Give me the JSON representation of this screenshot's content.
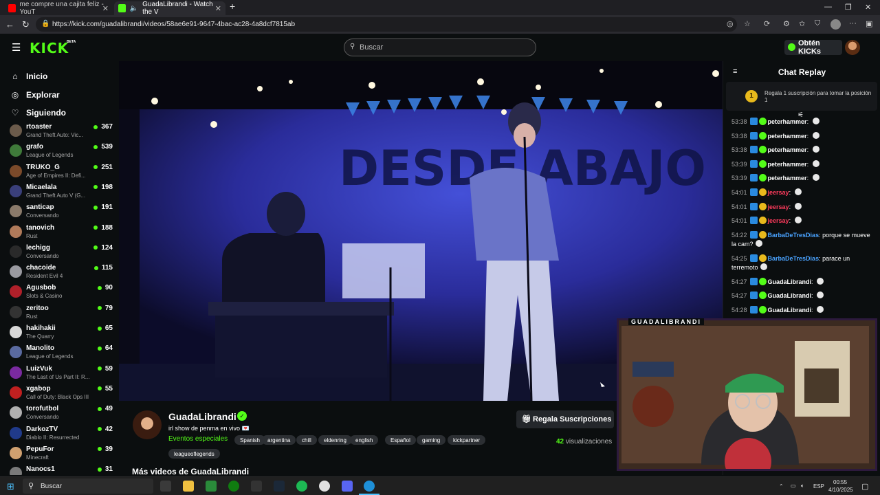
{
  "browser": {
    "tabs": [
      {
        "title": "me compre una cajita feliz - YouT",
        "favicon_color": "#ff0000"
      },
      {
        "title": "GuadaLibrandi - Watch the V",
        "favicon_color": "#53fc18"
      }
    ],
    "url": "https://kick.com/guadalibrandi/videos/58ae6e91-9647-4bac-ac28-4a8dcf7815ab"
  },
  "header": {
    "logo": "KICK",
    "logo_badge": "BETA",
    "search_placeholder": "Buscar",
    "kicks_button": "Obtén KICKs"
  },
  "sidebar": {
    "nav": [
      {
        "label": "Inicio",
        "icon": "home-icon"
      },
      {
        "label": "Explorar",
        "icon": "compass-icon"
      },
      {
        "label": "Siguiendo",
        "icon": "heart-icon"
      }
    ],
    "channels": [
      {
        "name": "rtoaster",
        "game": "Grand Theft Auto: Vic...",
        "viewers": "367",
        "color": "#6b5b4b"
      },
      {
        "name": "grafo",
        "game": "League of Legends",
        "viewers": "539",
        "color": "#3f7a3a"
      },
      {
        "name": "TRUKO_G",
        "game": "Age of Empires II: Defi...",
        "viewers": "251",
        "color": "#7b4a2a"
      },
      {
        "name": "Micaelala",
        "game": "Grand Theft Auto V (G...",
        "viewers": "198",
        "color": "#3a3f7a"
      },
      {
        "name": "santicap",
        "game": "Conversando",
        "viewers": "191",
        "color": "#8a7a6a"
      },
      {
        "name": "tanovich",
        "game": "Rust",
        "viewers": "188",
        "color": "#b07a5a"
      },
      {
        "name": "lechigg",
        "game": "Conversando",
        "viewers": "124",
        "color": "#2a2a2a"
      },
      {
        "name": "chacoide",
        "game": "Resident Evil 4",
        "viewers": "115",
        "color": "#9a9aa0"
      },
      {
        "name": "Agusbob",
        "game": "Slots & Casino",
        "viewers": "90",
        "color": "#b0202a"
      },
      {
        "name": "zeritoo",
        "game": "Rust",
        "viewers": "79",
        "color": "#333"
      },
      {
        "name": "hakihakii",
        "game": "The Quarry",
        "viewers": "65",
        "color": "#d8d8d8"
      },
      {
        "name": "Manolito",
        "game": "League of Legends",
        "viewers": "64",
        "color": "#5a6aa0"
      },
      {
        "name": "LuizVuk",
        "game": "The Last of Us Part II: R...",
        "viewers": "59",
        "color": "#7a2aa0"
      },
      {
        "name": "xgabop",
        "game": "Call of Duty: Black Ops III",
        "viewers": "55",
        "color": "#c02020"
      },
      {
        "name": "torofutbol",
        "game": "Conversando",
        "viewers": "49",
        "color": "#b0b0b0"
      },
      {
        "name": "DarkozTV",
        "game": "Diablo II: Resurrected",
        "viewers": "42",
        "color": "#203a8a"
      },
      {
        "name": "PepuFor",
        "game": "Minecraft",
        "viewers": "39",
        "color": "#d0a070"
      },
      {
        "name": "Nanocs1",
        "game": "",
        "viewers": "31",
        "color": "#7a7a7a"
      }
    ]
  },
  "video": {
    "backdrop_text": "DESDE ABAJO"
  },
  "stream_info": {
    "streamer": "GuadaLibrandi",
    "title": "irl show de penma en vivo 💌",
    "category": "Eventos especiales",
    "tags": [
      "Spanish",
      "argentina",
      "chill",
      "eldenring",
      "english",
      "Español",
      "gaming",
      "kickpartner",
      "leagueoflegends"
    ],
    "gift_button": "Regala Suscripciones",
    "views_count": "42",
    "views_label": "visualizaciones",
    "more_videos": "Más videos de GuadaLibrandi"
  },
  "chat": {
    "title": "Chat Replay",
    "gift_banner_count": "1",
    "gift_banner_text": "Regala 1 suscripción para tomar la posición 1",
    "messages": [
      {
        "time": "53:38",
        "user": "peterhammer",
        "text": "",
        "color": "#ffffff",
        "badge": "#53fc18"
      },
      {
        "time": "53:38",
        "user": "peterhammer",
        "text": "",
        "color": "#ffffff",
        "badge": "#53fc18"
      },
      {
        "time": "53:38",
        "user": "peterhammer",
        "text": "",
        "color": "#ffffff",
        "badge": "#53fc18"
      },
      {
        "time": "53:39",
        "user": "peterhammer",
        "text": "",
        "color": "#ffffff",
        "badge": "#53fc18"
      },
      {
        "time": "53:39",
        "user": "peterhammer",
        "text": "",
        "color": "#ffffff",
        "badge": "#53fc18"
      },
      {
        "time": "54:01",
        "user": "jeersay",
        "text": "",
        "color": "#ff3b5c",
        "badge": "#e8b91c"
      },
      {
        "time": "54:01",
        "user": "jeersay",
        "text": "",
        "color": "#ff3b5c",
        "badge": "#e8b91c"
      },
      {
        "time": "54:01",
        "user": "jeersay",
        "text": "",
        "color": "#ff3b5c",
        "badge": "#e8b91c"
      },
      {
        "time": "54:22",
        "user": "BarbaDeTresDias",
        "text": "porque se mueve la cam?",
        "color": "#4aa3ff",
        "badge": "#e8b91c"
      },
      {
        "time": "54:25",
        "user": "BarbaDeTresDias",
        "text": "parace un terremoto",
        "color": "#4aa3ff",
        "badge": "#e8b91c"
      },
      {
        "time": "54:27",
        "user": "GuadaLibrandi",
        "text": "",
        "color": "#ffffff",
        "badge": "#53fc18"
      },
      {
        "time": "54:27",
        "user": "GuadaLibrandi",
        "text": "",
        "color": "#ffffff",
        "badge": "#53fc18"
      },
      {
        "time": "54:28",
        "user": "GuadaLibrandi",
        "text": "",
        "color": "#ffffff",
        "badge": "#53fc18"
      }
    ]
  },
  "webcam": {
    "label": "GUADALIBRANDI"
  },
  "taskbar": {
    "search": "Buscar",
    "lang": "ESP",
    "time": "00:55",
    "date": "4/10/2025"
  }
}
